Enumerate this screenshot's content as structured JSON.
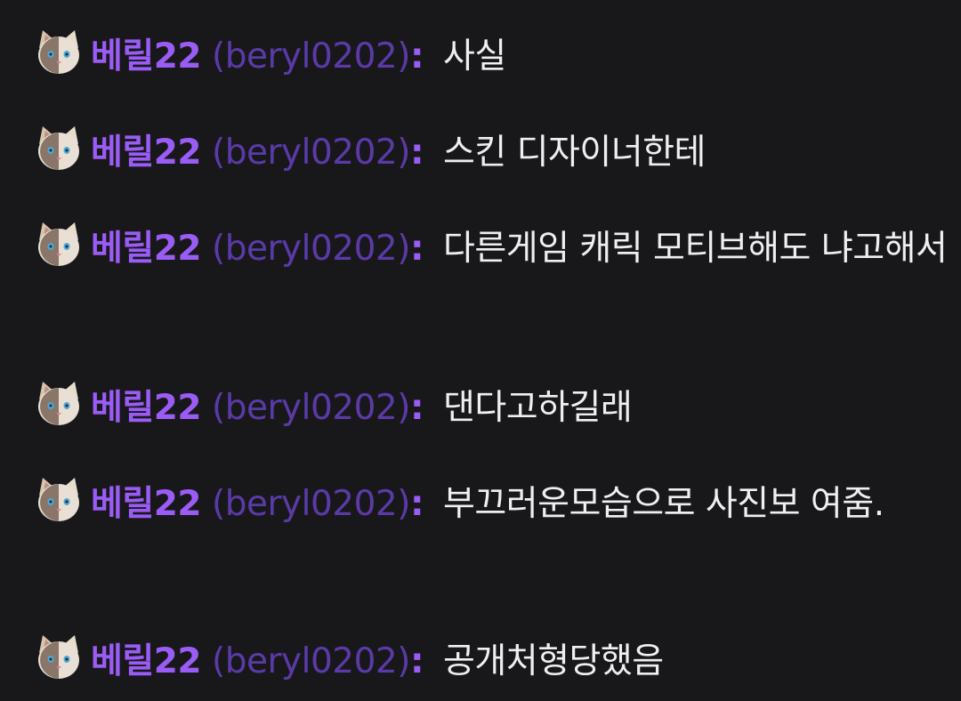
{
  "chat": {
    "messages": [
      {
        "badge_icon": "cat-face-icon",
        "display_name": "베릴22",
        "login": "(beryl0202)",
        "separator": ":",
        "text": "사실"
      },
      {
        "badge_icon": "cat-face-icon",
        "display_name": "베릴22",
        "login": "(beryl0202)",
        "separator": ":",
        "text": "스킨 디자이너한테"
      },
      {
        "badge_icon": "cat-face-icon",
        "display_name": "베릴22",
        "login": "(beryl0202)",
        "separator": ":",
        "text": "다른게임 캐릭 모티브해도 냐고해서"
      },
      {
        "badge_icon": "cat-face-icon",
        "display_name": "베릴22",
        "login": "(beryl0202)",
        "separator": ":",
        "text": "댄다고하길래"
      },
      {
        "badge_icon": "cat-face-icon",
        "display_name": "베릴22",
        "login": "(beryl0202)",
        "separator": ":",
        "text": "부끄러운모습으로 사진보 여줌."
      },
      {
        "badge_icon": "cat-face-icon",
        "display_name": "베릴22",
        "login": "(beryl0202)",
        "separator": ":",
        "text": "공개처형당했음"
      }
    ]
  },
  "colors": {
    "background": "#18181b",
    "display_name": "#9b5cf6",
    "login": "#5b3aa8",
    "message_text": "#efeff1"
  }
}
